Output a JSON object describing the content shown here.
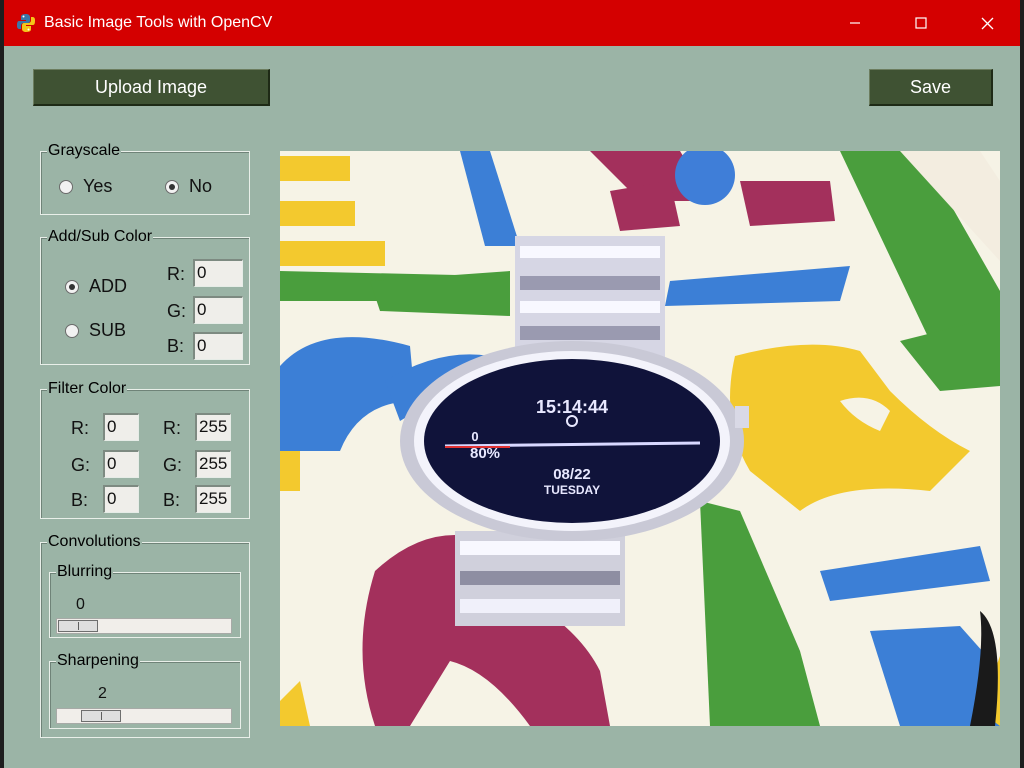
{
  "window": {
    "title": "Basic Image Tools with OpenCV",
    "controls": {
      "minimize": "—",
      "maximize": "☐",
      "close": "✕"
    },
    "titlebar_color": "#d40000",
    "background_color": "#9bb4a6"
  },
  "toolbar": {
    "upload_label": "Upload Image",
    "save_label": "Save"
  },
  "grayscale": {
    "title": "Grayscale",
    "options": [
      {
        "label": "Yes",
        "selected": false
      },
      {
        "label": "No",
        "selected": true
      }
    ]
  },
  "add_sub": {
    "title": "Add/Sub Color",
    "options": [
      {
        "label": "ADD",
        "selected": true
      },
      {
        "label": "SUB",
        "selected": false
      }
    ],
    "channels": [
      {
        "label": "R:",
        "value": "0"
      },
      {
        "label": "G:",
        "value": "0"
      },
      {
        "label": "B:",
        "value": "0"
      }
    ]
  },
  "filter": {
    "title": "Filter Color",
    "min": [
      {
        "label": "R:",
        "value": "0"
      },
      {
        "label": "G:",
        "value": "0"
      },
      {
        "label": "B:",
        "value": "0"
      }
    ],
    "max": [
      {
        "label": "R:",
        "value": "255"
      },
      {
        "label": "G:",
        "value": "255"
      },
      {
        "label": "B:",
        "value": "255"
      }
    ]
  },
  "convolutions": {
    "title": "Convolutions",
    "blurring": {
      "title": "Blurring",
      "value": "0"
    },
    "sharpening": {
      "title": "Sharpening",
      "value": "2"
    }
  },
  "image": {
    "subject": "wristwatch-on-patterned-mat",
    "watch_time": "15:14:44",
    "watch_date": "08/22",
    "watch_day": "TUESDAY",
    "watch_battery": "80%",
    "watch_steps": "0"
  }
}
